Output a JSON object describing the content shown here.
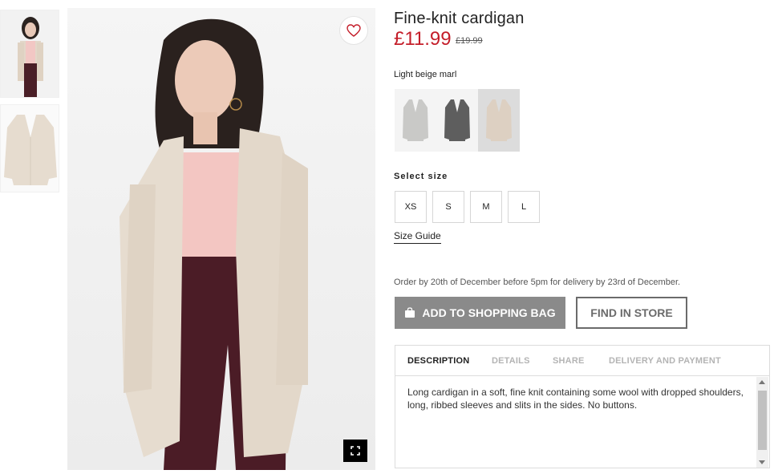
{
  "product": {
    "title": "Fine-knit cardigan",
    "price": "£11.99",
    "old_price": "£19.99",
    "color_label": "Light beige marl"
  },
  "gallery": {
    "thumbnails": [
      "model-view",
      "flat-view"
    ],
    "favorite_icon": "heart-icon",
    "expand_icon": "fullscreen-icon"
  },
  "swatches": [
    {
      "color": "light-grey-marl",
      "hex": "#c9c9c7"
    },
    {
      "color": "dark-grey",
      "hex": "#5e5e5e"
    },
    {
      "color": "light-beige-marl",
      "hex": "#ddd0c2",
      "selected": true
    }
  ],
  "sizes": {
    "label": "Select size",
    "options": [
      "XS",
      "S",
      "M",
      "L"
    ],
    "guide_label": "Size Guide"
  },
  "delivery_note": "Order by 20th of December before 5pm for delivery by 23rd of December.",
  "actions": {
    "add_to_bag": "ADD TO SHOPPING BAG",
    "find_in_store": "FIND IN STORE"
  },
  "tabs": {
    "items": [
      "DESCRIPTION",
      "DETAILS",
      "SHARE",
      "DELIVERY AND PAYMENT"
    ],
    "active": "DESCRIPTION"
  },
  "description": "Long cardigan in a soft, fine knit containing some wool with dropped shoulders, long, ribbed sleeves and slits in the sides. No buttons.",
  "colors": {
    "price_red": "#c41e2a",
    "button_grey": "#8a8a8a",
    "outline_grey": "#6b6b6b"
  }
}
